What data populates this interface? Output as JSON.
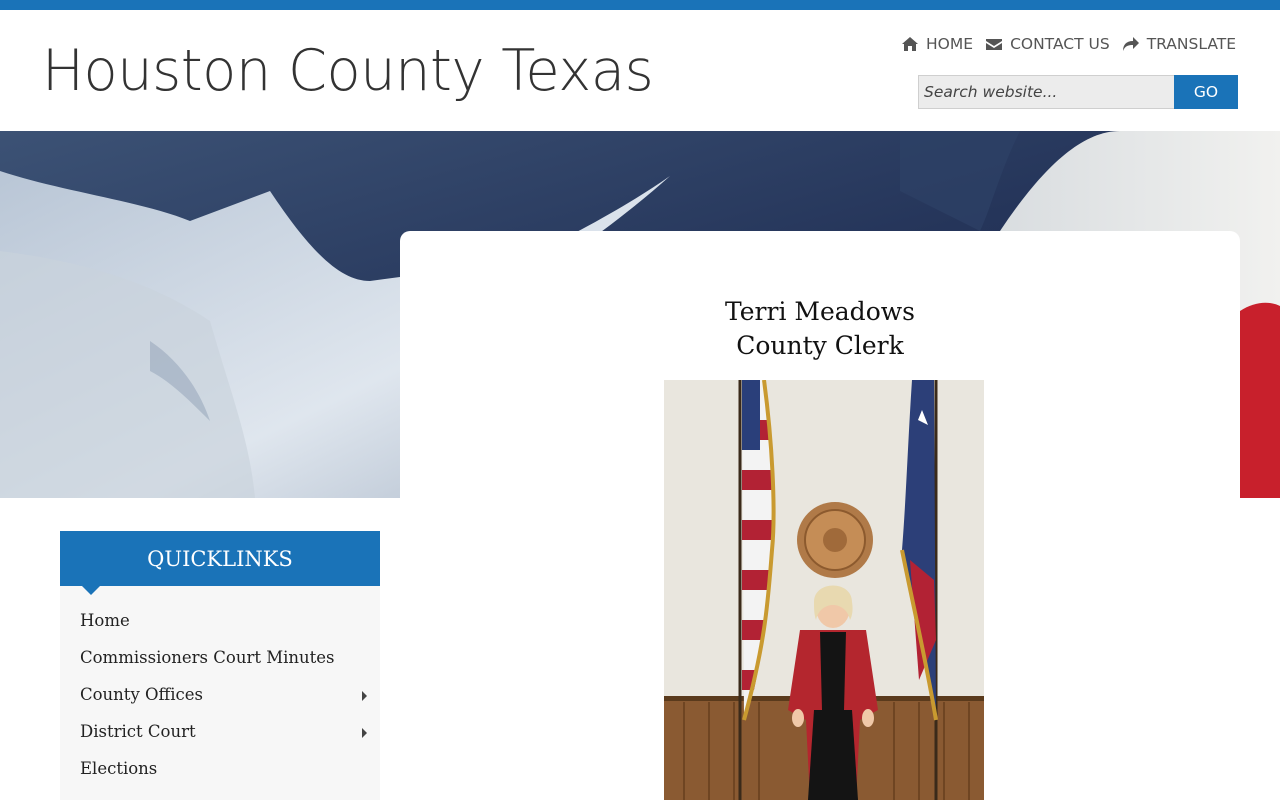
{
  "site": {
    "title": "Houston County Texas"
  },
  "nav": {
    "home": {
      "label": "HOME",
      "icon": "home-icon"
    },
    "contact": {
      "label": "CONTACT US",
      "icon": "envelope-icon"
    },
    "translate": {
      "label": "TRANSLATE",
      "icon": "share-arrow-icon"
    }
  },
  "search": {
    "placeholder": "Search website...",
    "button_label": "GO"
  },
  "content": {
    "name": "Terri Meadows",
    "role": "County Clerk"
  },
  "quicklinks": {
    "heading": "QUICKLINKS",
    "items": [
      {
        "label": "Home",
        "submenu": false
      },
      {
        "label": "Commissioners Court Minutes",
        "submenu": false
      },
      {
        "label": "County Offices",
        "submenu": true
      },
      {
        "label": "District Court",
        "submenu": true
      },
      {
        "label": "Elections",
        "submenu": false
      }
    ]
  },
  "colors": {
    "accent": "#1a73b8",
    "topbar": "#1a73b8"
  }
}
